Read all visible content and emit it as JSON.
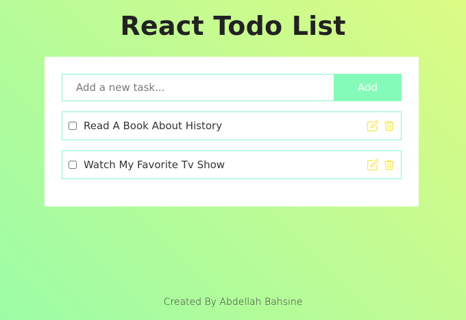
{
  "app": {
    "title": "React Todo List"
  },
  "form": {
    "input_value": "",
    "input_placeholder": "Add a new task...",
    "add_label": "Add"
  },
  "todos": [
    {
      "text": "Read A Book About History",
      "checked": false
    },
    {
      "text": "Watch My Favorite Tv Show",
      "checked": false
    }
  ],
  "footer": {
    "credit": "Created By Abdellah Bahsine"
  },
  "colors": {
    "accent": "#84fbb8",
    "icon": "#f5e96a",
    "border": "#86f7c4"
  },
  "icons": {
    "edit": "edit-icon",
    "delete": "trash-icon"
  }
}
